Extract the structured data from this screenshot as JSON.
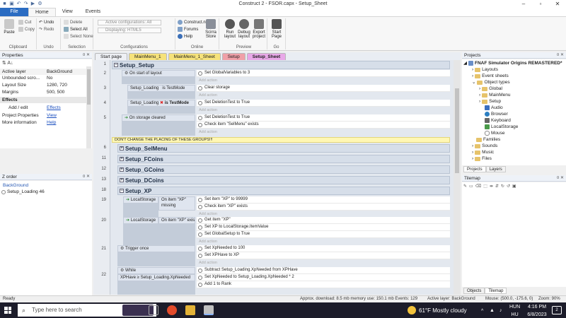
{
  "window": {
    "title": "Construct 2 - FSOR.capx - Setup_Sheet"
  },
  "ribbon_tabs": [
    "File",
    "Home",
    "View",
    "Events"
  ],
  "ribbon": {
    "clipboard": {
      "paste": "Paste",
      "cut": "Cut",
      "copy": "Copy",
      "group": "Clipboard"
    },
    "undo": {
      "undo": "Undo",
      "redo": "Redo",
      "group": "Undo"
    },
    "selection": {
      "delete": "Delete",
      "select_all": "Select All",
      "select_none": "Select None",
      "group": "Selection"
    },
    "configurations": {
      "active": "Active configurations: All",
      "displaying": "Displaying: HTML5",
      "group": "Configurations"
    },
    "online": {
      "construct_net": "Construct.net",
      "forums": "Forums",
      "help": "Help",
      "store": "Scirra Store",
      "group": "Online"
    },
    "preview": {
      "run": "Run layout",
      "debug": "Debug layout",
      "export": "Export project",
      "group": "Preview"
    },
    "go": {
      "start_page": "Start Page",
      "group": "Go"
    }
  },
  "properties": {
    "title": "Properties",
    "rows": [
      {
        "key": "Active layer",
        "value": "BackGround"
      },
      {
        "key": "Unbounded scro...",
        "value": "No"
      },
      {
        "key": "Layout Size",
        "value": "1280, 720"
      },
      {
        "key": "Margins",
        "value": "500, 500"
      }
    ],
    "effects_section": "Effects",
    "links": [
      {
        "key": "Add / edit",
        "value": "Effects"
      },
      {
        "key": "Project Properties",
        "value": "View"
      },
      {
        "key": "More information",
        "value": "Help"
      }
    ]
  },
  "zorder": {
    "title": "Z order",
    "layer": "BackGround",
    "item": "Setup_Loading 46"
  },
  "doc_tabs": [
    {
      "label": "Start page",
      "color": "#eef0f4"
    },
    {
      "label": "MainMenu_1",
      "color": "#f6e27a"
    },
    {
      "label": "MainMenu_1_Sheet",
      "color": "#f6e27a"
    },
    {
      "label": "Setup",
      "color": "#f0a0a8"
    },
    {
      "label": "Setup_Sheet",
      "color": "#e8a8e8"
    }
  ],
  "events": {
    "group_title": "Setup_Setup",
    "e2": {
      "cond": "On start of layout",
      "act1": "Set GlobalVariables to 3",
      "obj1": "System",
      "obj2": "System"
    },
    "e3": {
      "cond_obj": "Setup_Loading",
      "cond": "is TestMode",
      "act": "Clear storage"
    },
    "e4": {
      "cond_obj": "Setup_Loading",
      "cond": "is TestMode",
      "act": "Set DeletionTest to True"
    },
    "e5": {
      "cond_obj": "LocalStorage",
      "cond": "On storage cleared",
      "act1": "Set DeletionTest to True",
      "act2": "Check item \"SelMenu\" exists"
    },
    "comment": "DON'T CHANGE THE PLACING OF THESE GROUPS!!!",
    "groups": [
      "Setup_SelMenu",
      "Setup_FCoins",
      "Setup_GCoins",
      "Setup_DCoins",
      "Setup_XP"
    ],
    "e19": {
      "cond_obj": "LocalStorage",
      "cond": "On item \"XP\" missing",
      "act1": "Set item \"XP\" to 99999",
      "act2": "Check item \"XP\" exists"
    },
    "e20": {
      "cond_obj": "LocalStorage",
      "cond": "On item \"XP\" exists",
      "act1": "Get item \"XP\"",
      "act2": "Set XP to LocalStorage.ItemValue",
      "act3": "Set GlobalSetup to True"
    },
    "e21": {
      "cond": "Trigger once",
      "act1": "Set XpNeeded to 100",
      "act2": "Set XPHave to XP"
    },
    "e22": {
      "cond1": "While",
      "cond2": "XPHave ≥ Setup_Loading.XpNeeded",
      "act1": "Subtract Setup_Loading.XpNeeded from XPHave",
      "act2": "Set XpNeeded to Setup_Loading.XpNeeded * 2",
      "act3": "Add 1 to Rank"
    },
    "add_action": "Add action"
  },
  "line_numbers": [
    "1",
    "2",
    "3",
    "4",
    "5",
    "6",
    "11",
    "12",
    "13",
    "18",
    "19",
    "20",
    "21",
    "22"
  ],
  "projects": {
    "title": "Projects",
    "root": "FNAF Simulator Origins REMASTERED*",
    "items": [
      "Layouts",
      "Event sheets",
      "Object types",
      "Global",
      "MainMenu",
      "Setup",
      "Audio",
      "Browser",
      "Keyboard",
      "LocalStorage",
      "Mouse",
      "Families",
      "Sounds",
      "Music",
      "Files"
    ],
    "tabs": [
      "Projects",
      "Layers"
    ]
  },
  "tilemap": {
    "title": "Tilemap",
    "tabs": [
      "Objects",
      "Tilemap"
    ]
  },
  "status": {
    "ready": "Ready",
    "download": "Approx. download: 8.5 mb  memory use: 150.1 mb  Events: 129",
    "layer": "Active layer: BackGround",
    "mouse": "Mouse: (500.0, -175.6, 0)",
    "zoom": "Zoom: 90%"
  },
  "taskbar": {
    "search_placeholder": "Type here to search",
    "weather": "61°F  Mostly cloudy",
    "lang1": "HUN",
    "lang2": "HU",
    "time": "4:16 PM",
    "date": "6/8/2023",
    "notifications": "2"
  }
}
